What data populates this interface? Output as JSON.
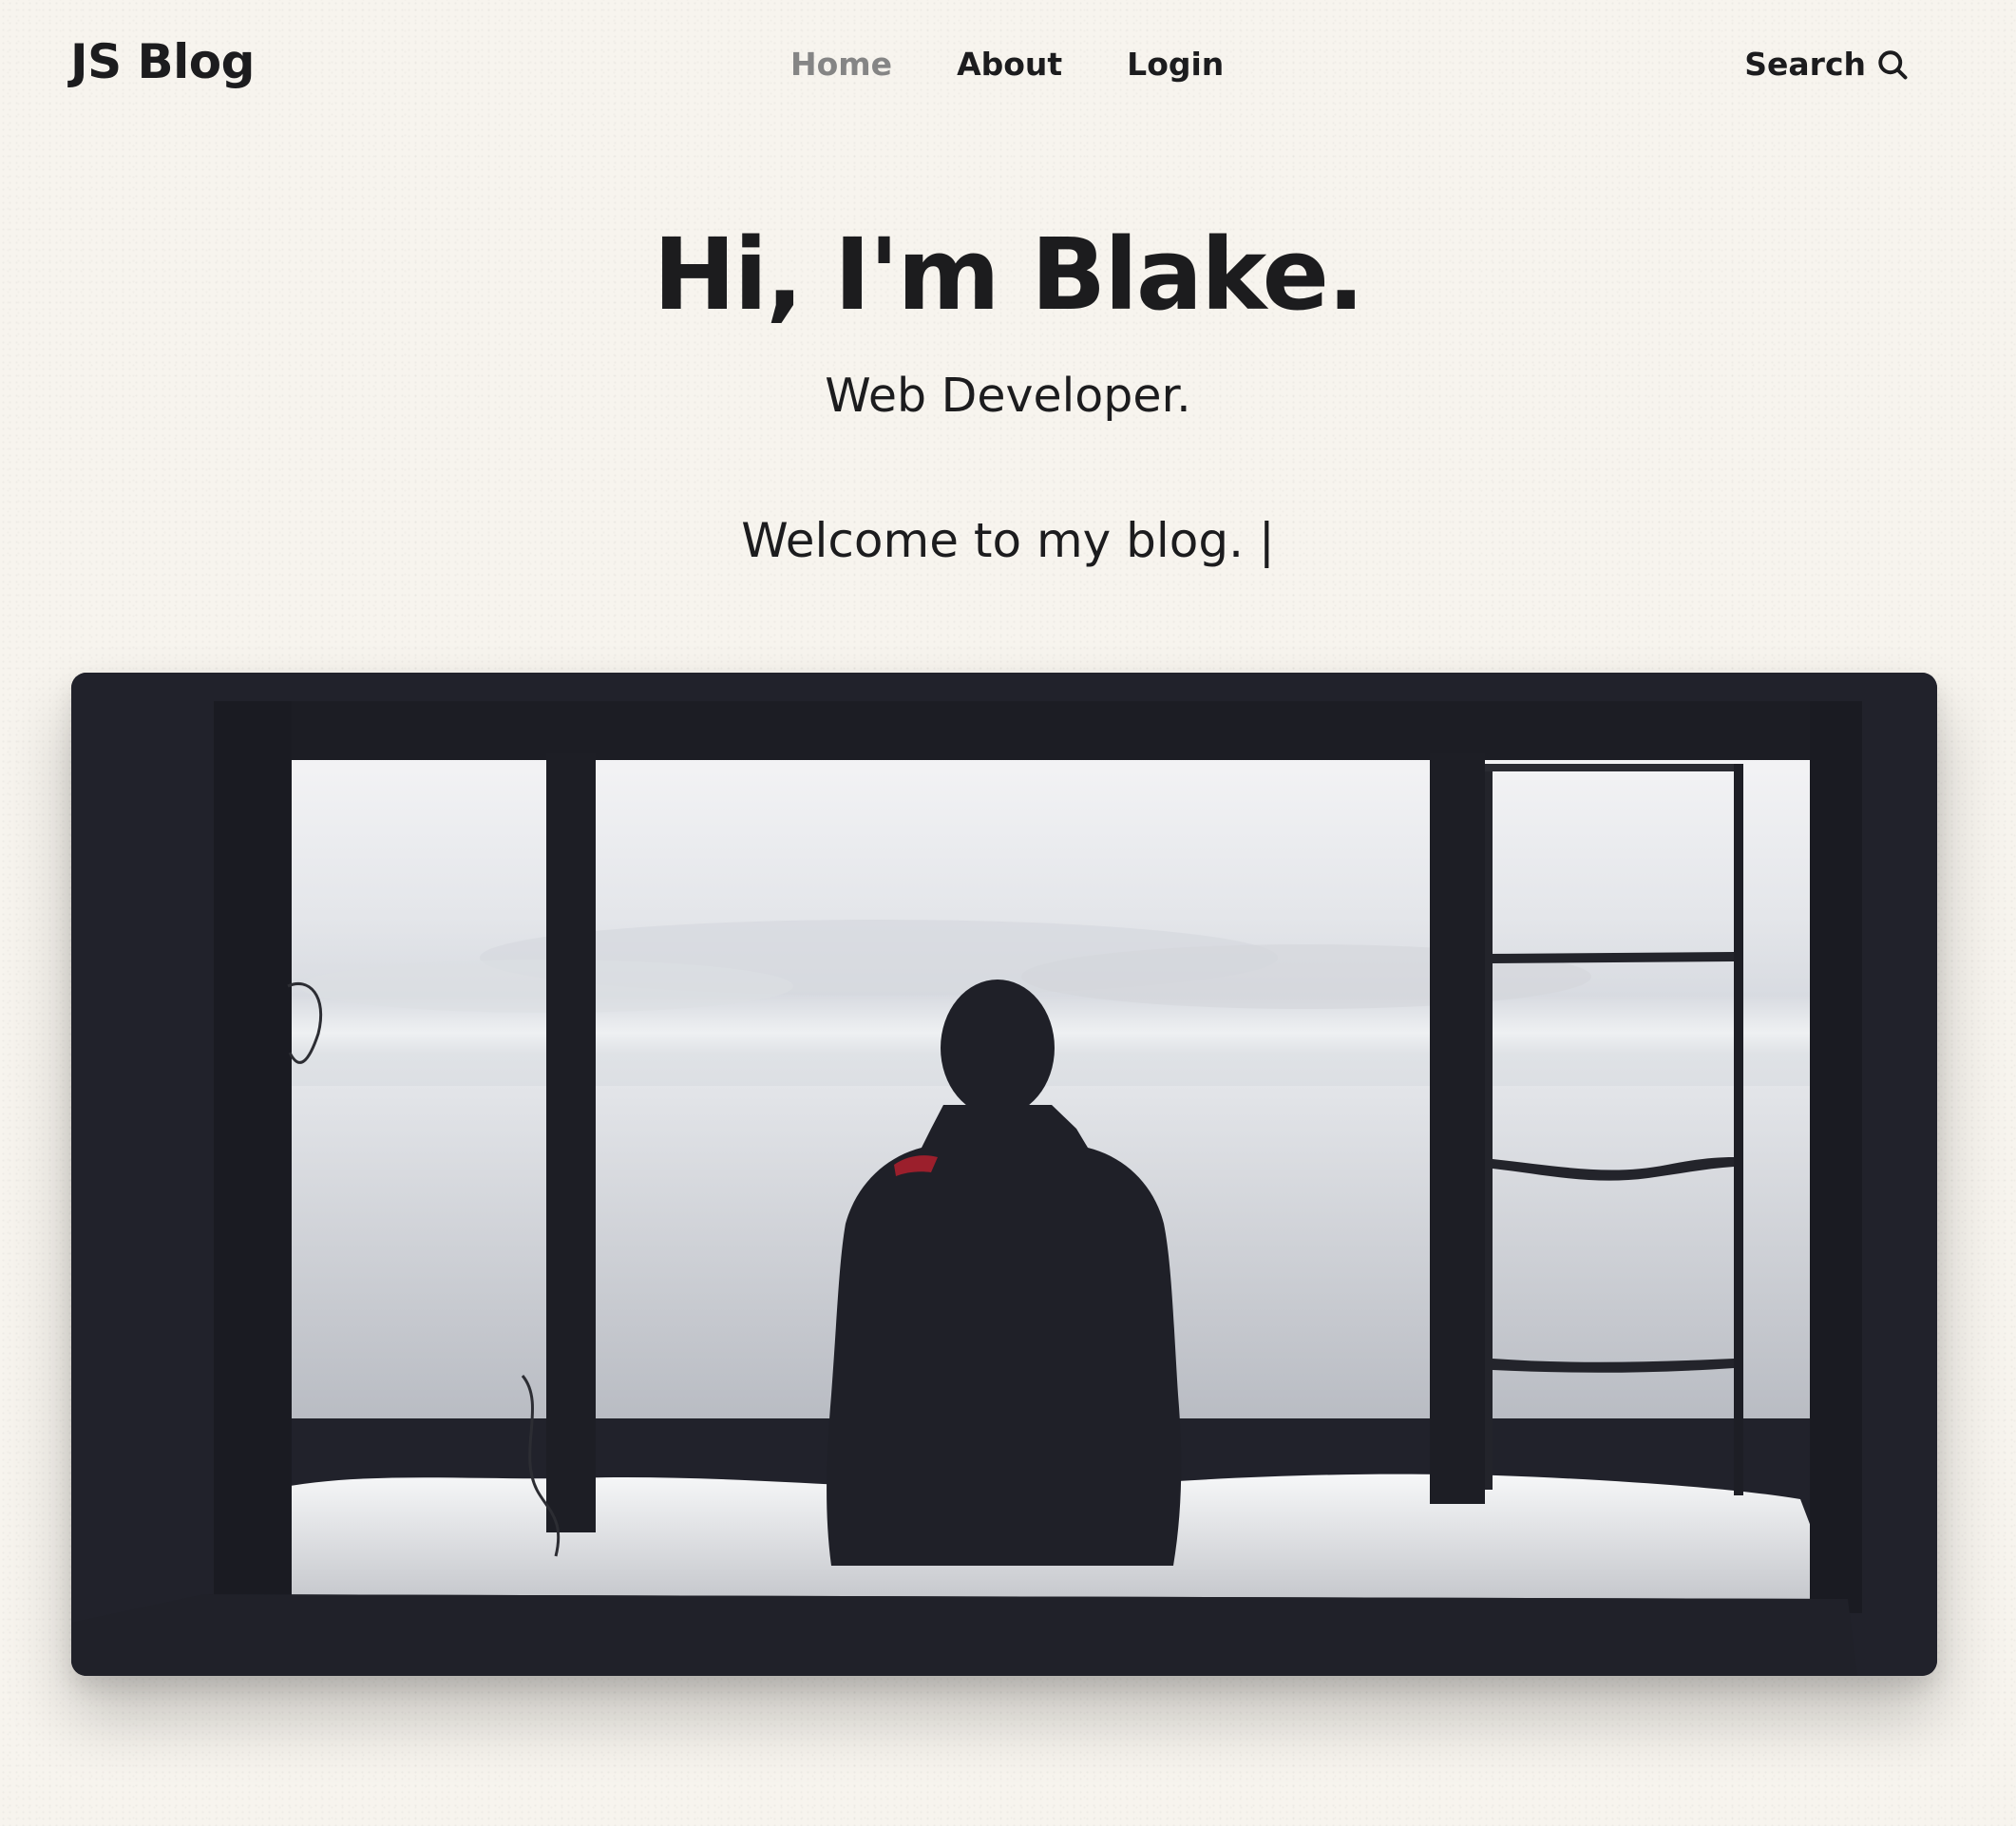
{
  "header": {
    "brand": "JS Blog",
    "nav": [
      {
        "label": "Home",
        "active": true
      },
      {
        "label": "About",
        "active": false
      },
      {
        "label": "Login",
        "active": false
      }
    ],
    "search_label": "Search",
    "search_icon": "magnifier"
  },
  "hero": {
    "title": "Hi, I'm Blake.",
    "subtitle": "Web Developer.",
    "welcome": "Welcome to my blog. |"
  },
  "featured_image": {
    "subject": "silhouette-window-sea"
  },
  "colors": {
    "background": "#f7f4ee",
    "text": "#1c1c1e",
    "nav_active": "#858585",
    "image_frame": "#21222b"
  }
}
